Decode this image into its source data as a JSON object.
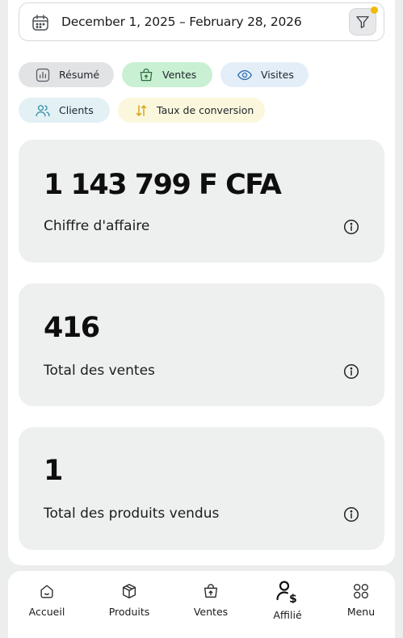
{
  "date_range": {
    "text": "December 1, 2025 – February 28, 2026",
    "filter_badge_color": "#f0b90b"
  },
  "chips": {
    "resume": "Résumé",
    "ventes": "Ventes",
    "visites": "Visites",
    "clients": "Clients",
    "taux": "Taux de conversion"
  },
  "chip_colors": {
    "resume": "#e2e3e5",
    "ventes": "#c9f0d3",
    "visites": "#e4eef8",
    "clients": "#e3f1f5",
    "taux": "#fbf7dd"
  },
  "stats": [
    {
      "value": "1 143 799 F CFA",
      "label": "Chiffre d'affaire",
      "icon": "info-icon"
    },
    {
      "value": "416",
      "label": "Total des ventes",
      "icon": "info-icon"
    },
    {
      "value": "1",
      "label": "Total des produits vendus",
      "icon": "info-icon"
    }
  ],
  "bottom_nav": {
    "items": [
      {
        "label": "Accueil",
        "icon": "home-icon"
      },
      {
        "label": "Produits",
        "icon": "box-icon"
      },
      {
        "label": "Ventes",
        "icon": "shopping-bag-icon"
      },
      {
        "label": "Affilié",
        "icon": "affiliate-user-dollar-icon"
      },
      {
        "label": "Menu",
        "icon": "grid-menu-icon"
      }
    ]
  }
}
